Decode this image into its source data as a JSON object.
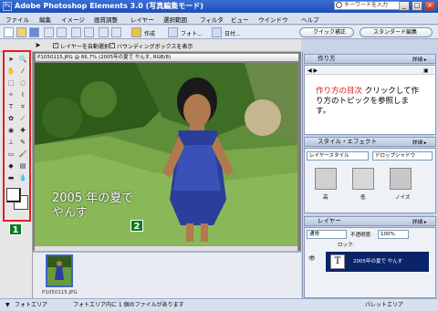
{
  "window": {
    "title": "Adobe Photoshop Elements 3.0 (写真編集モード)",
    "app_icon": "Ps",
    "buttons": [
      "_",
      "□",
      "×"
    ]
  },
  "menu": {
    "items": [
      "ファイル",
      "編集",
      "イメージ",
      "画質調整",
      "レイヤー",
      "選択範囲",
      "フィルタ",
      "ビュー",
      "ウインドウ",
      "ヘルプ"
    ],
    "search_placeholder": "キーワードを入力"
  },
  "shortcuts": {
    "create_label": "作成",
    "photo_label": "フォト...",
    "date_label": "日付...",
    "quickfix_label": "クイック補正",
    "standard_label": "スタンダード編集"
  },
  "options": {
    "auto_select": "レイヤーを自動選択",
    "bounding_box": "バウンディングボックスを表示"
  },
  "document": {
    "title": "P1050115.JPG @ 66.7% (2005年の夏で やんす, RGB/8)",
    "caption_line1": "2005 年の夏で",
    "caption_line2": "やんす"
  },
  "callouts": {
    "one": "1",
    "two": "2"
  },
  "photobin": {
    "thumb_name": "P1050115.JPG"
  },
  "palettes": {
    "howto": {
      "title": "作り方",
      "more": "詳細 ▸",
      "text_hl": "作り方の目次",
      "text_rest": " クリックして作り方のトピックを参照します。"
    },
    "effects": {
      "title": "スタイル・エフェクト",
      "more": "詳細 ▸",
      "category": "レイヤースタイル",
      "subcategory": "ドロップシャドウ",
      "thumbs": [
        "高",
        "低",
        "ノイズ"
      ]
    },
    "layers": {
      "title": "レイヤー",
      "more": "詳細 ▸",
      "mode": "通常",
      "opacity_label": "不透明度:",
      "opacity_value": "100%",
      "lock_label": "ロック:",
      "layer_name": "2005年の夏で やんす"
    }
  },
  "status": {
    "photo_area": "フォトエリア",
    "photo_area_info": "フォトエリア内に 1 個のファイルがあります",
    "palette_area": "パレットエリア"
  },
  "colors": {
    "callout_green": "#0a7a20",
    "highlight_red": "#e02020",
    "howto_red": "#e01818",
    "layer_selected": "#0a246a"
  }
}
